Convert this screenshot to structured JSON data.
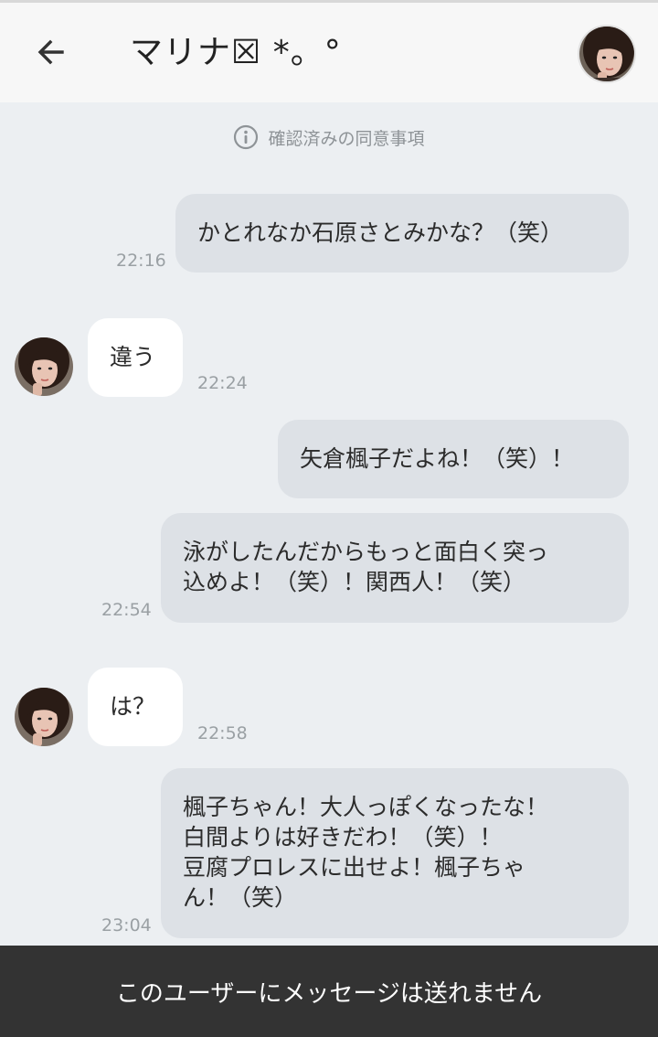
{
  "header": {
    "title": "マリナ☒ *。°",
    "back_icon": "arrow-left-icon",
    "avatar_icon": "profile-avatar"
  },
  "consent": {
    "icon": "info-circle-icon",
    "label": "確認済みの同意事項"
  },
  "messages": [
    {
      "side": "out",
      "text": "かとれなか石原さとみかな？（笑）",
      "time": "22:16"
    },
    {
      "side": "in",
      "text": "違う",
      "time": "22:24"
    },
    {
      "side": "out",
      "text": "矢倉楓子だよね！（笑）！",
      "time": ""
    },
    {
      "side": "out",
      "text": "泳がしたんだからもっと面白く突っ\n込めよ！（笑）！関西人！（笑）",
      "time": "22:54"
    },
    {
      "side": "in",
      "text": "は？",
      "time": "22:58"
    },
    {
      "side": "out",
      "text": "楓子ちゃん！大人っぽくなったな！\n白間よりは好きだわ！（笑）！\n豆腐プロレスに出せよ！楓子ちゃ\nん！（笑）",
      "time": "23:04"
    }
  ],
  "bottom_bar": {
    "label": "このユーザーにメッセージは送れません"
  },
  "colors": {
    "background": "#eceff2",
    "header": "#f7f7f7",
    "outgoing_bubble": "#dde1e6",
    "incoming_bubble": "#ffffff",
    "bottom_bar": "#333333"
  }
}
